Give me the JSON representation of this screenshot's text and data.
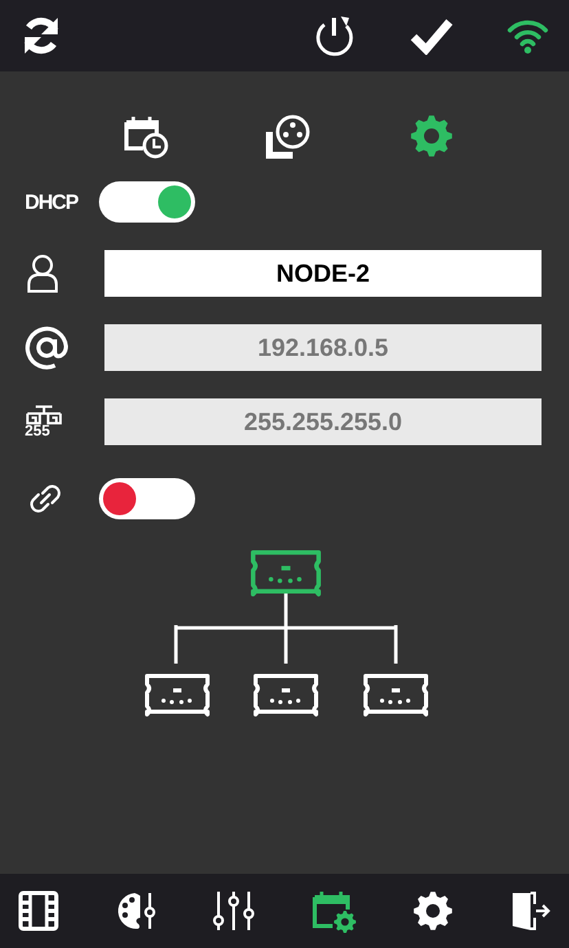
{
  "top_bar": {
    "wifi": {
      "connected": true
    }
  },
  "sub_tabs": [
    {
      "kind": "schedule",
      "selected": false
    },
    {
      "kind": "dmx",
      "selected": false
    },
    {
      "kind": "settings",
      "selected": true
    }
  ],
  "dhcp": {
    "label": "DHCP",
    "on": true
  },
  "fields": [
    {
      "kind": "name",
      "value": "NODE-2",
      "disabled": false
    },
    {
      "kind": "ip",
      "value": "192.168.0.5",
      "disabled": true
    },
    {
      "kind": "mask",
      "value": "255.255.255.0",
      "disabled": true,
      "icon_label": "255"
    }
  ],
  "link": {
    "on": false
  },
  "bottom_nav": [
    {
      "kind": "film",
      "selected": false
    },
    {
      "kind": "palette",
      "selected": false
    },
    {
      "kind": "sliders",
      "selected": false
    },
    {
      "kind": "schedule-settings",
      "selected": true
    },
    {
      "kind": "settings",
      "selected": false
    },
    {
      "kind": "exit",
      "selected": false
    }
  ]
}
